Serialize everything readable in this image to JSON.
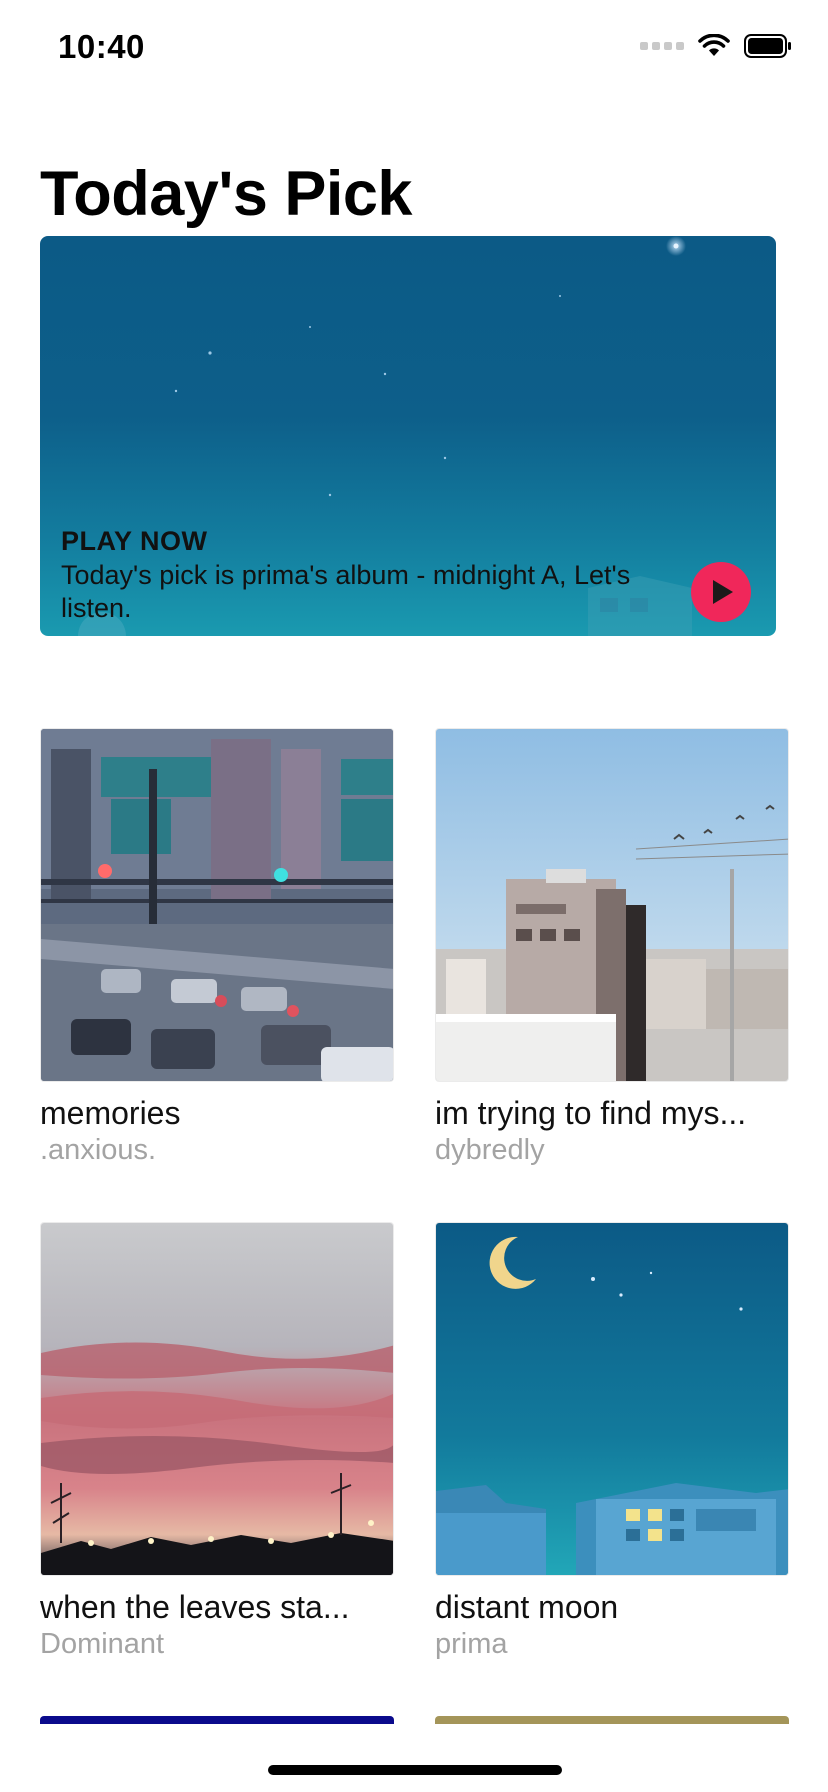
{
  "status_bar": {
    "time": "10:40"
  },
  "header": {
    "title": "Today's Pick"
  },
  "hero": {
    "eyebrow": "PLAY NOW",
    "description": "Today's pick is prima's album - midnight A, Let's listen.",
    "play_icon": "play-icon",
    "colors": {
      "play_button": "#f0275a",
      "background_top": "#0c5a86",
      "background_bottom": "#1a9ab0"
    }
  },
  "albums": [
    {
      "title": "memories",
      "artist": ".anxious."
    },
    {
      "title": "im trying to find mys...",
      "artist": "dybredly"
    },
    {
      "title": "when the leaves sta...",
      "artist": "Dominant"
    },
    {
      "title": "distant moon",
      "artist": "prima"
    }
  ],
  "colors": {
    "secondary_text": "#a3a3a3",
    "accent": "#f0275a"
  }
}
